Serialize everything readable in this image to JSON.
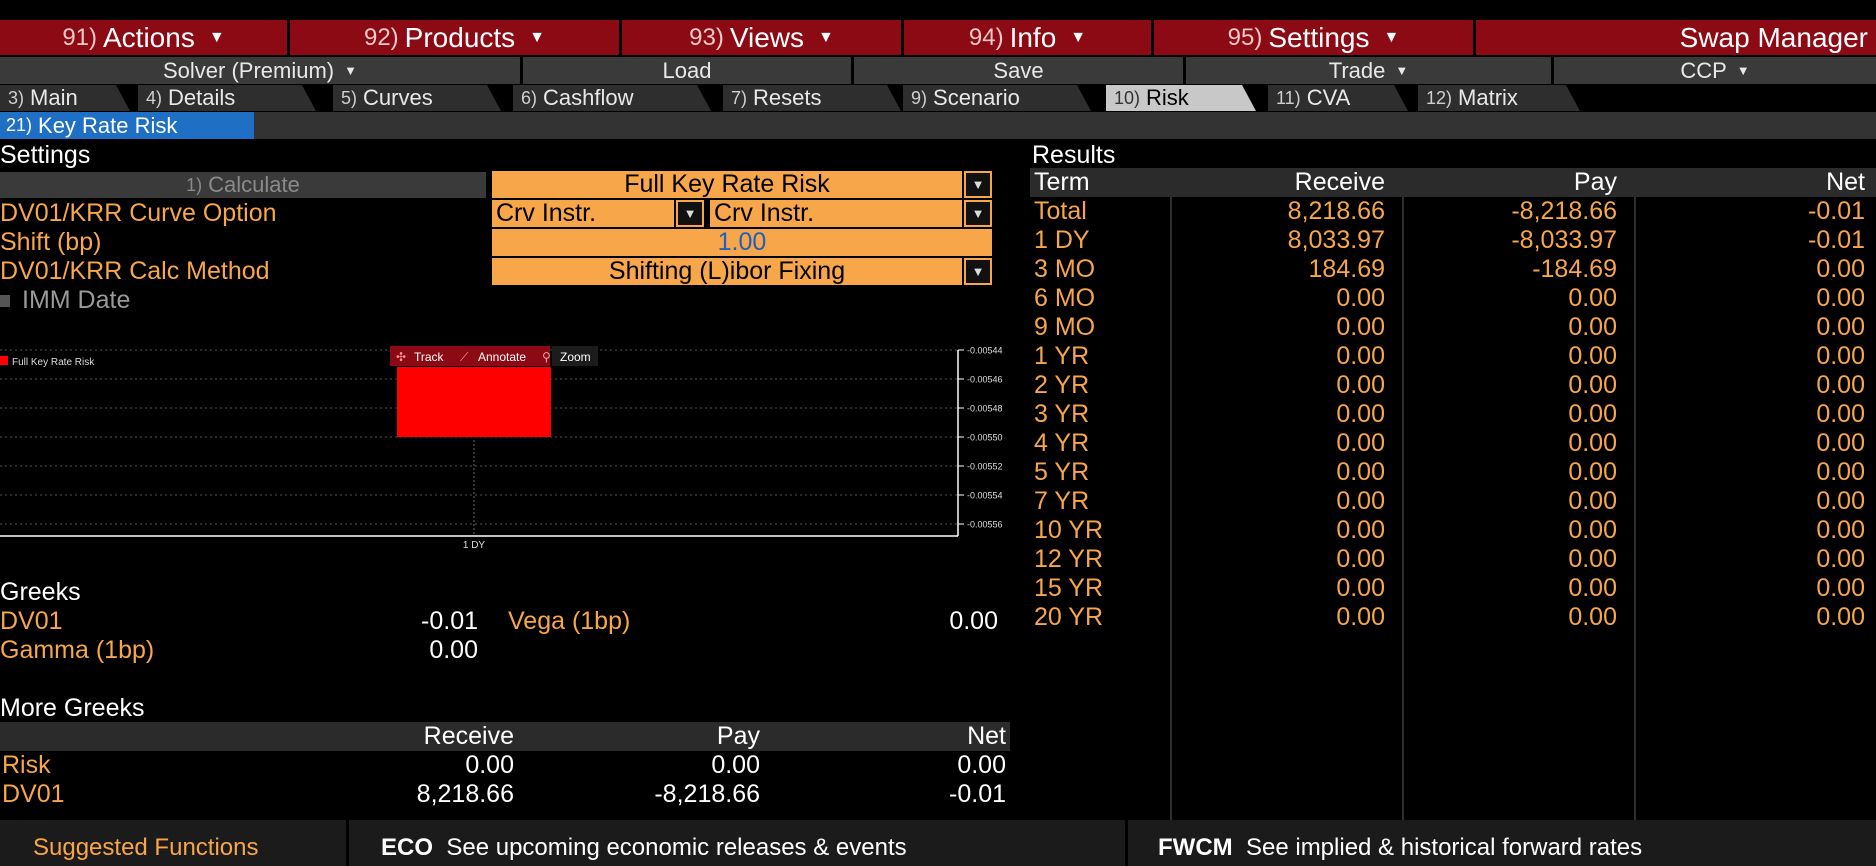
{
  "menu": {
    "items": [
      {
        "num": "91)",
        "label": "Actions"
      },
      {
        "num": "92)",
        "label": "Products"
      },
      {
        "num": "93)",
        "label": "Views"
      },
      {
        "num": "94)",
        "label": "Info"
      },
      {
        "num": "95)",
        "label": "Settings"
      }
    ],
    "title": "Swap Manager"
  },
  "secondbar": {
    "solver": "Solver (Premium)",
    "load": "Load",
    "save": "Save",
    "trade": "Trade",
    "ccp": "CCP"
  },
  "tabs": [
    {
      "num": "3)",
      "label": "Main"
    },
    {
      "num": "4)",
      "label": "Details"
    },
    {
      "num": "5)",
      "label": "Curves"
    },
    {
      "num": "6)",
      "label": "Cashflow"
    },
    {
      "num": "7)",
      "label": "Resets"
    },
    {
      "num": "9)",
      "label": "Scenario"
    },
    {
      "num": "10)",
      "label": "Risk",
      "active": true
    },
    {
      "num": "11)",
      "label": "CVA"
    },
    {
      "num": "12)",
      "label": "Matrix"
    }
  ],
  "subtab": {
    "num": "21)",
    "label": "Key Rate Risk"
  },
  "settings": {
    "title": "Settings",
    "calculate": {
      "num": "1)",
      "label": "Calculate"
    },
    "risk_mode": "Full Key Rate Risk",
    "curve_option_label": "DV01/KRR Curve Option",
    "curve_option_1": "Crv Instr.",
    "curve_option_2": "Crv Instr.",
    "shift_label": "Shift (bp)",
    "shift_value": "1.00",
    "calc_method_label": "DV01/KRR Calc Method",
    "calc_method": "Shifting (L)ibor Fixing",
    "imm_label": "IMM Date"
  },
  "chart_toolbar": {
    "track": "Track",
    "annotate": "Annotate",
    "zoom": "Zoom"
  },
  "chart_data": {
    "type": "bar",
    "legend": "Full Key Rate Risk",
    "categories": [
      "1 DY"
    ],
    "values": [
      -0.0055
    ],
    "ylim": [
      -0.00556,
      -0.00544
    ],
    "yticks": [
      "-0.00544",
      "-0.00546",
      "-0.00548",
      "-0.00550",
      "-0.00552",
      "-0.00554",
      "-0.00556"
    ],
    "bar_color": "#ff0000",
    "grid": true,
    "axis_side": "right"
  },
  "results": {
    "title": "Results",
    "headers": {
      "term": "Term",
      "receive": "Receive",
      "pay": "Pay",
      "net": "Net"
    },
    "rows": [
      {
        "term": "Total",
        "receive": "8,218.66",
        "pay": "-8,218.66",
        "net": "-0.01"
      },
      {
        "term": "1 DY",
        "receive": "8,033.97",
        "pay": "-8,033.97",
        "net": "-0.01"
      },
      {
        "term": "3 MO",
        "receive": "184.69",
        "pay": "-184.69",
        "net": "0.00"
      },
      {
        "term": "6 MO",
        "receive": "0.00",
        "pay": "0.00",
        "net": "0.00"
      },
      {
        "term": "9 MO",
        "receive": "0.00",
        "pay": "0.00",
        "net": "0.00"
      },
      {
        "term": "1 YR",
        "receive": "0.00",
        "pay": "0.00",
        "net": "0.00"
      },
      {
        "term": "2 YR",
        "receive": "0.00",
        "pay": "0.00",
        "net": "0.00"
      },
      {
        "term": "3 YR",
        "receive": "0.00",
        "pay": "0.00",
        "net": "0.00"
      },
      {
        "term": "4 YR",
        "receive": "0.00",
        "pay": "0.00",
        "net": "0.00"
      },
      {
        "term": "5 YR",
        "receive": "0.00",
        "pay": "0.00",
        "net": "0.00"
      },
      {
        "term": "7 YR",
        "receive": "0.00",
        "pay": "0.00",
        "net": "0.00"
      },
      {
        "term": "10 YR",
        "receive": "0.00",
        "pay": "0.00",
        "net": "0.00"
      },
      {
        "term": "12 YR",
        "receive": "0.00",
        "pay": "0.00",
        "net": "0.00"
      },
      {
        "term": "15 YR",
        "receive": "0.00",
        "pay": "0.00",
        "net": "0.00"
      },
      {
        "term": "20 YR",
        "receive": "0.00",
        "pay": "0.00",
        "net": "0.00"
      }
    ]
  },
  "greeks": {
    "title": "Greeks",
    "dv01_label": "DV01",
    "dv01_value": "-0.01",
    "vega_label": "Vega (1bp)",
    "vega_value": "0.00",
    "gamma_label": "Gamma (1bp)",
    "gamma_value": "0.00"
  },
  "more_greeks": {
    "title": "More Greeks",
    "headers": {
      "receive": "Receive",
      "pay": "Pay",
      "net": "Net"
    },
    "rows": [
      {
        "name": "Risk",
        "receive": "0.00",
        "pay": "0.00",
        "net": "0.00"
      },
      {
        "name": "DV01",
        "receive": "8,218.66",
        "pay": "-8,218.66",
        "net": "-0.01"
      }
    ]
  },
  "footer": {
    "suggested": "Suggested Functions",
    "f1_code": "ECO",
    "f1_desc": "See upcoming economic releases & events",
    "f2_code": "FWCM",
    "f2_desc": "See implied & historical forward rates"
  },
  "colors": {
    "menu_red": "#8b0a14",
    "accent_orange": "#f7a64a",
    "subtab_blue": "#1f6fc5",
    "chart_bar": "#ff0000"
  }
}
